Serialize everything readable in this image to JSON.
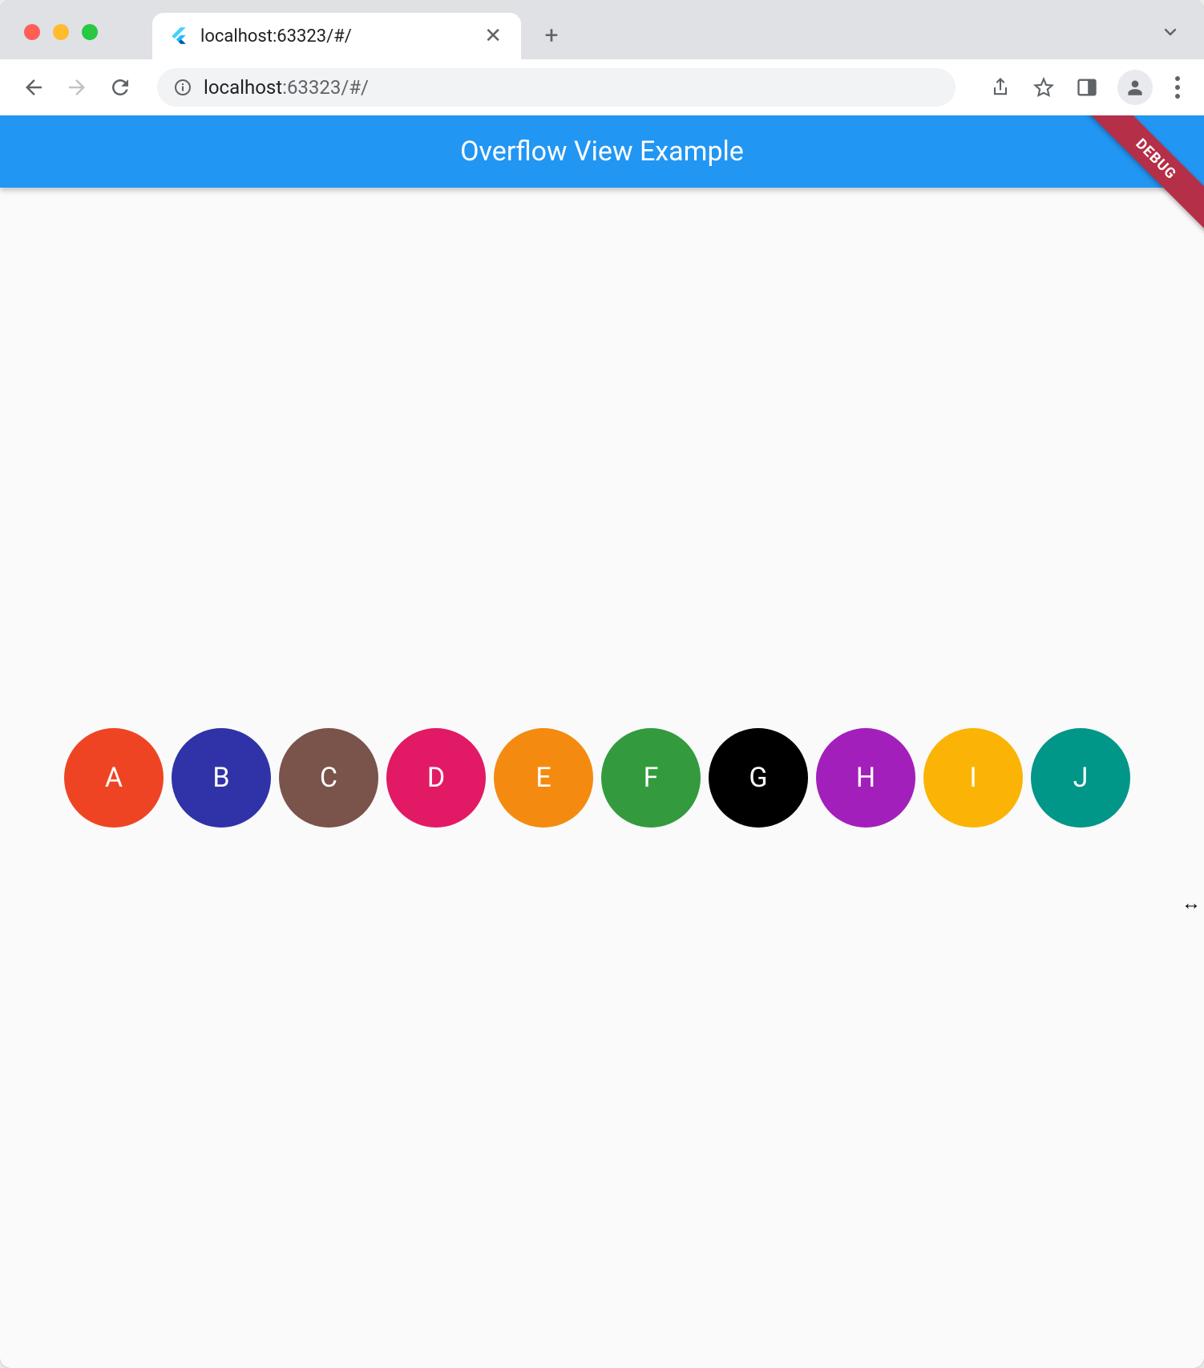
{
  "browser": {
    "tab_title": "localhost:63323/#/",
    "new_tab_label": "+",
    "url_host": "localhost",
    "url_port_path": ":63323/#/"
  },
  "app": {
    "title": "Overflow View Example",
    "debug_label": "DEBUG"
  },
  "avatars": [
    {
      "label": "A",
      "color": "#ef4424"
    },
    {
      "label": "B",
      "color": "#3033a7"
    },
    {
      "label": "C",
      "color": "#7a534a"
    },
    {
      "label": "D",
      "color": "#e21a66"
    },
    {
      "label": "E",
      "color": "#f48b10"
    },
    {
      "label": "F",
      "color": "#339b3e"
    },
    {
      "label": "G",
      "color": "#000000"
    },
    {
      "label": "H",
      "color": "#a31fbb"
    },
    {
      "label": "I",
      "color": "#fbb406"
    },
    {
      "label": "J",
      "color": "#009688"
    }
  ]
}
